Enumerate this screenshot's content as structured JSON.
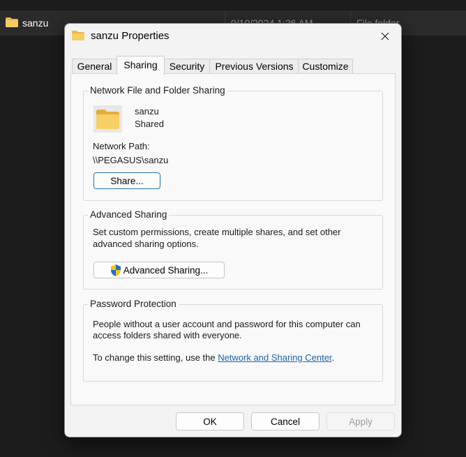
{
  "background": {
    "file_name": "sanzu",
    "date": "9/10/2024 1:26 AM",
    "type": "File folder"
  },
  "dialog": {
    "title": "sanzu Properties",
    "close_icon": "close-icon"
  },
  "tabs": [
    {
      "label": "General"
    },
    {
      "label": "Sharing",
      "active": true
    },
    {
      "label": "Security"
    },
    {
      "label": "Previous Versions"
    },
    {
      "label": "Customize"
    }
  ],
  "network_sharing": {
    "group_title": "Network File and Folder Sharing",
    "folder_name": "sanzu",
    "status": "Shared",
    "path_label": "Network Path:",
    "path_value": "\\\\PEGASUS\\sanzu",
    "share_button": "Share..."
  },
  "advanced_sharing": {
    "group_title": "Advanced Sharing",
    "description_line1": "Set custom permissions, create multiple shares, and set other",
    "description_line2": "advanced sharing options.",
    "button": "Advanced Sharing..."
  },
  "password_protection": {
    "group_title": "Password Protection",
    "line1": "People without a user account and password for this computer can",
    "line2": "access folders shared with everyone.",
    "change_prefix": "To change this setting, use the ",
    "link": "Network and Sharing Center",
    "change_suffix": "."
  },
  "footer": {
    "ok": "OK",
    "cancel": "Cancel",
    "apply": "Apply"
  }
}
